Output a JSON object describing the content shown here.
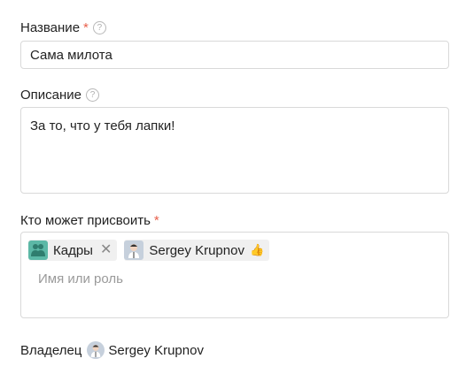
{
  "title_field": {
    "label": "Название",
    "required_mark": "*",
    "help": "?",
    "value": "Сама милота"
  },
  "description_field": {
    "label": "Описание",
    "help": "?",
    "value": "За то, что у тебя лапки!"
  },
  "assign_field": {
    "label": "Кто может присвоить",
    "required_mark": "*",
    "chips": [
      {
        "label": "Кадры",
        "icon": "group-icon",
        "remove": "✕"
      },
      {
        "label": "Sergey Krupnov",
        "icon": "user-avatar",
        "badge": "👍"
      }
    ],
    "placeholder": "Имя или роль"
  },
  "owner": {
    "label": "Владелец",
    "name": "Sergey Krupnov"
  },
  "colors": {
    "required": "#e8604c",
    "group_avatar": "#5cb8a6",
    "border": "#d9d9d9"
  }
}
